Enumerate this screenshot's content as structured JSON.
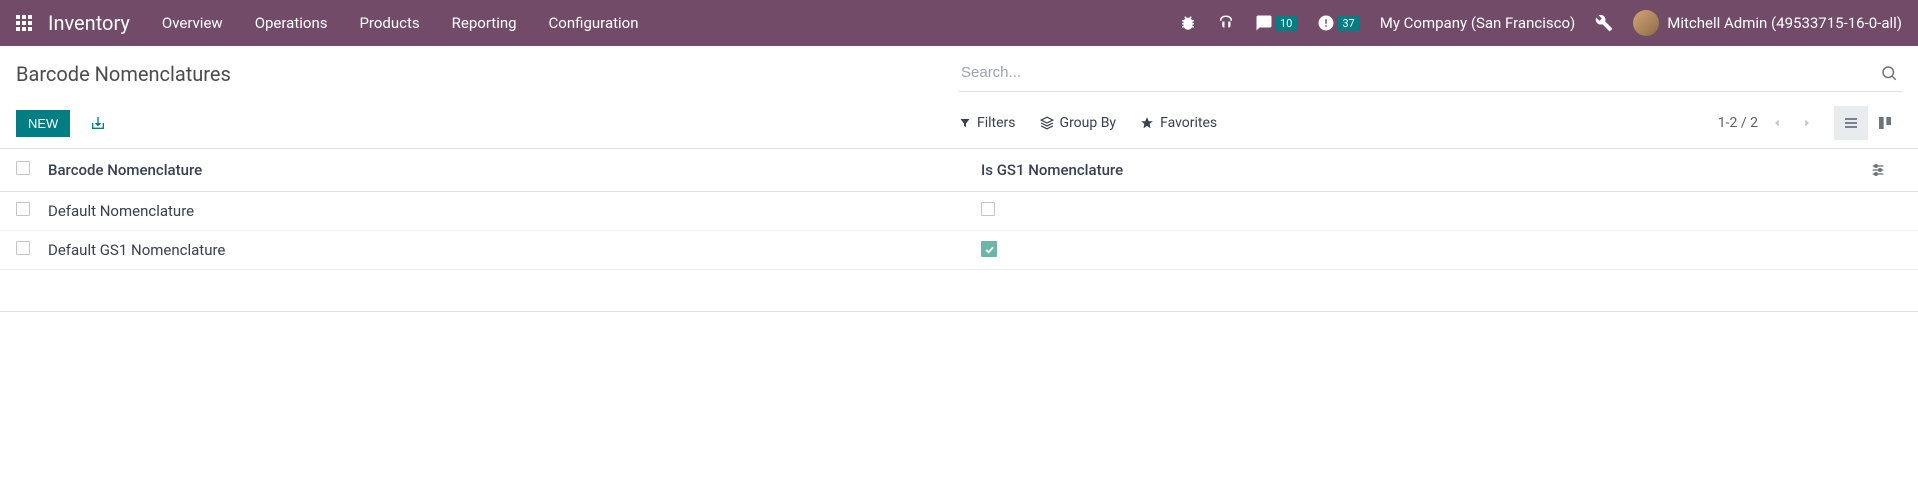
{
  "topbar": {
    "brand": "Inventory",
    "menu": [
      "Overview",
      "Operations",
      "Products",
      "Reporting",
      "Configuration"
    ],
    "discuss_badge": "10",
    "activities_badge": "37",
    "company": "My Company (San Francisco)",
    "user": "Mitchell Admin (49533715-16-0-all)"
  },
  "breadcrumb": "Barcode Nomenclatures",
  "search": {
    "placeholder": "Search..."
  },
  "buttons": {
    "new": "NEW"
  },
  "options": {
    "filters": "Filters",
    "groupby": "Group By",
    "favorites": "Favorites"
  },
  "pager": "1-2 / 2",
  "columns": {
    "name": "Barcode Nomenclature",
    "is_gs1": "Is GS1 Nomenclature"
  },
  "rows": [
    {
      "name": "Default Nomenclature",
      "is_gs1": false
    },
    {
      "name": "Default GS1 Nomenclature",
      "is_gs1": true
    }
  ]
}
